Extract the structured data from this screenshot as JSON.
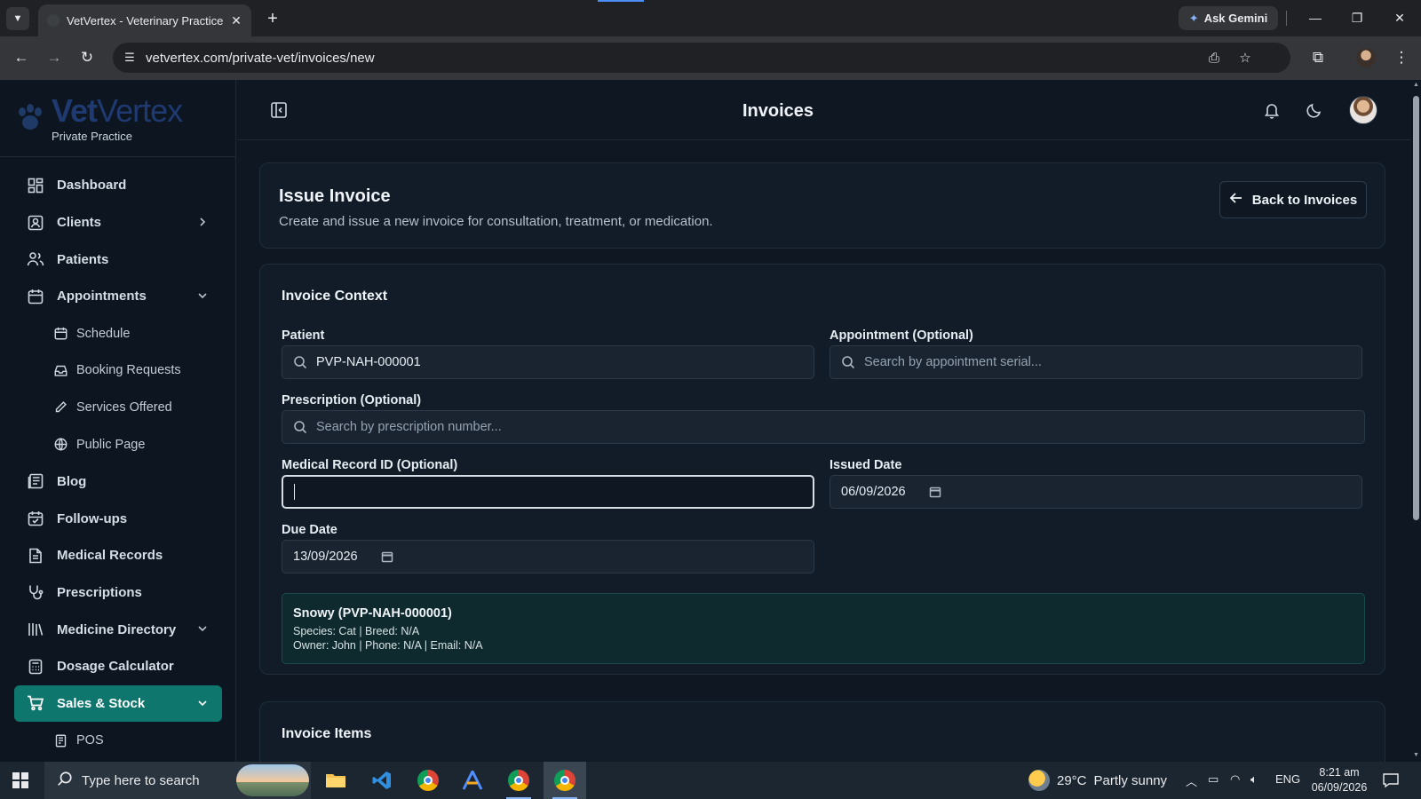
{
  "browser": {
    "tab_title": "VetVertex - Veterinary Practice M",
    "url": "vetvertex.com/private-vet/invoices/new",
    "ask_gemini": "Ask Gemini"
  },
  "brand": {
    "name_bold": "Vet",
    "name_rest": "Vertex",
    "subtitle": "Private Practice",
    "color": "#1e3a70"
  },
  "sidebar": {
    "items": [
      {
        "label": "Dashboard",
        "icon": "dashboard-icon"
      },
      {
        "label": "Clients",
        "icon": "clients-icon",
        "chevron": "right"
      },
      {
        "label": "Patients",
        "icon": "patients-icon"
      },
      {
        "label": "Appointments",
        "icon": "calendar-icon",
        "chevron": "down"
      },
      {
        "label": "Schedule",
        "icon": "calendar-icon",
        "sub": true
      },
      {
        "label": "Booking Requests",
        "icon": "inbox-icon",
        "sub": true
      },
      {
        "label": "Services Offered",
        "icon": "pen-icon",
        "sub": true
      },
      {
        "label": "Public Page",
        "icon": "globe-icon",
        "sub": true
      },
      {
        "label": "Blog",
        "icon": "blog-icon"
      },
      {
        "label": "Follow-ups",
        "icon": "calendar-check-icon"
      },
      {
        "label": "Medical Records",
        "icon": "file-icon"
      },
      {
        "label": "Prescriptions",
        "icon": "stethoscope-icon"
      },
      {
        "label": "Medicine Directory",
        "icon": "library-icon",
        "chevron": "down"
      },
      {
        "label": "Dosage Calculator",
        "icon": "calculator-icon"
      },
      {
        "label": "Sales & Stock",
        "icon": "cart-icon",
        "chevron": "down",
        "active": true
      },
      {
        "label": "POS",
        "icon": "receipt-icon",
        "sub": true
      }
    ],
    "active_color": "#0f766e"
  },
  "header": {
    "title": "Invoices"
  },
  "issue": {
    "title": "Issue Invoice",
    "description": "Create and issue a new invoice for consultation, treatment, or medication.",
    "back_label": "Back to Invoices"
  },
  "context": {
    "title": "Invoice Context",
    "patient_label": "Patient",
    "patient_value": "PVP-NAH-000001",
    "appointment_label": "Appointment (Optional)",
    "appointment_placeholder": "Search by appointment serial...",
    "prescription_label": "Prescription (Optional)",
    "prescription_placeholder": "Search by prescription number...",
    "medical_record_label": "Medical Record ID (Optional)",
    "issued_date_label": "Issued Date",
    "issued_date_value": "06/09/2026",
    "due_date_label": "Due Date",
    "due_date_value": "13/09/2026",
    "patient_card": {
      "name": "Snowy (PVP-NAH-000001)",
      "line1": "Species: Cat | Breed: N/A",
      "line2": "Owner: John | Phone: N/A | Email: N/A"
    }
  },
  "items": {
    "title": "Invoice Items"
  },
  "taskbar": {
    "search_placeholder": "Type here to search",
    "weather_temp": "29°C",
    "weather_desc": "Partly sunny",
    "lang": "ENG",
    "time": "8:21 am",
    "date": "06/09/2026"
  }
}
